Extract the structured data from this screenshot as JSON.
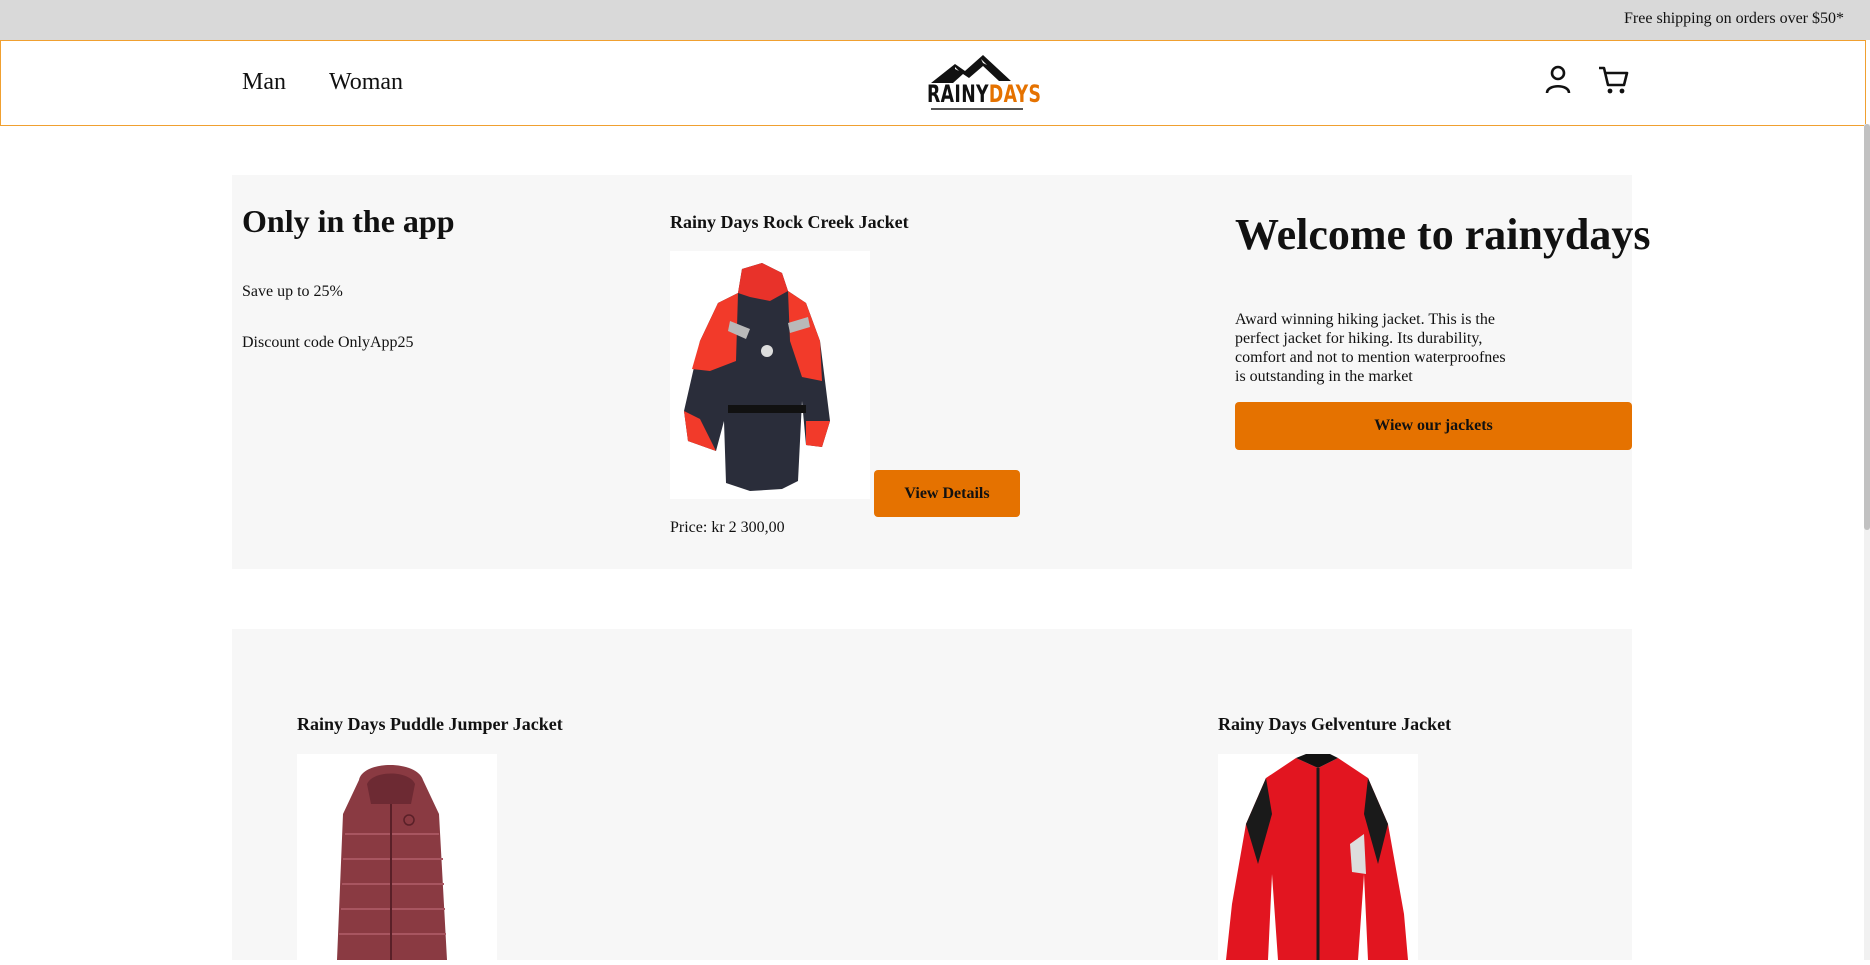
{
  "topbar": {
    "shipping_text": "Free shipping on orders over $50*"
  },
  "nav": {
    "links": [
      "Man",
      "Woman"
    ],
    "logo": {
      "part1": "RAINY",
      "part2": "DAYS"
    },
    "icons": [
      "user-icon",
      "cart-icon"
    ]
  },
  "promo": {
    "title": "Only in the app",
    "line1": "Save up to 25%",
    "line2": "Discount code OnlyApp25"
  },
  "featured": {
    "name": "Rainy Days Rock Creek Jacket",
    "price": "Price: kr 2 300,00",
    "button": "View Details"
  },
  "welcome": {
    "title": "Welcome to rainydays",
    "text": "Award winning hiking jacket. This is the perfect jacket for hiking. Its durability, comfort and not to mention waterproofnes is outstanding in the market",
    "button": "Wiew our jackets"
  },
  "products": [
    {
      "name": "Rainy Days Puddle Jumper Jacket"
    },
    {
      "name": "Rainy Days Gelventure Jacket"
    }
  ],
  "colors": {
    "accent": "#e57200",
    "topbar": "#d9d9d9",
    "panel": "#f7f7f7",
    "nav_border": "#f0a030"
  }
}
